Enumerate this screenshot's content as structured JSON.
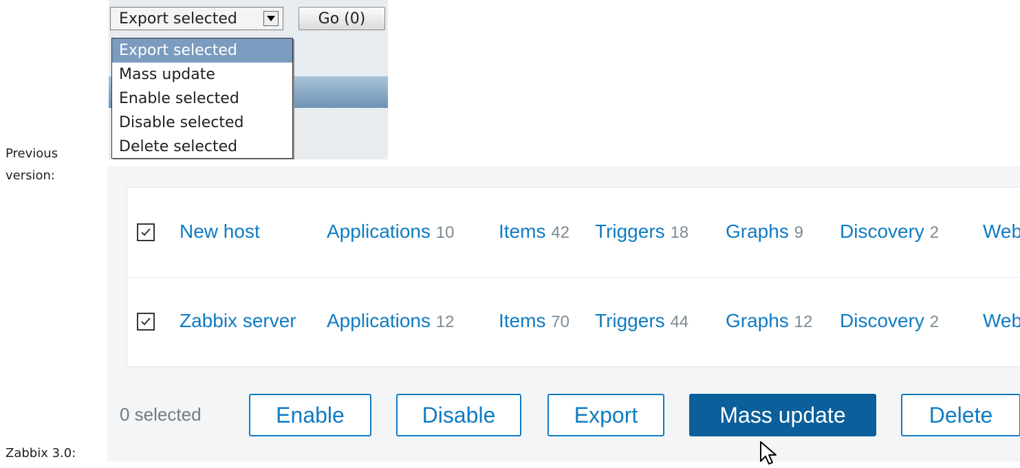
{
  "captions": {
    "previous": "Previous\nversion:",
    "current": "Zabbix 3.0:"
  },
  "old_ui": {
    "select_value": "Export selected",
    "go_button": "Go (0)",
    "options": [
      "Export selected",
      "Mass update",
      "Enable selected",
      "Disable selected",
      "Delete selected"
    ]
  },
  "new_ui": {
    "rows": [
      {
        "host": "New host",
        "links": [
          {
            "label": "Applications",
            "count": "10"
          },
          {
            "label": "Items",
            "count": "42"
          },
          {
            "label": "Triggers",
            "count": "18"
          },
          {
            "label": "Graphs",
            "count": "9"
          },
          {
            "label": "Discovery",
            "count": "2"
          },
          {
            "label": "Web",
            "count": ""
          }
        ]
      },
      {
        "host": "Zabbix server",
        "links": [
          {
            "label": "Applications",
            "count": "12"
          },
          {
            "label": "Items",
            "count": "70"
          },
          {
            "label": "Triggers",
            "count": "44"
          },
          {
            "label": "Graphs",
            "count": "12"
          },
          {
            "label": "Discovery",
            "count": "2"
          },
          {
            "label": "Web",
            "count": ""
          }
        ]
      }
    ],
    "selected_count": "0 selected",
    "buttons": {
      "enable": "Enable",
      "disable": "Disable",
      "export": "Export",
      "mass_update": "Mass update",
      "delete": "Delete"
    }
  },
  "colors": {
    "link": "#0f7bc3",
    "primary_button": "#0b5f9a",
    "old_selected_option": "#7b9bbf"
  }
}
